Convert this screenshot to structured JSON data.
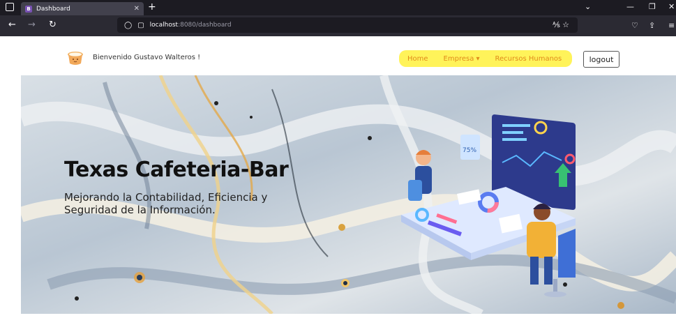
{
  "browser": {
    "tab_title": "Dashboard",
    "tab_favicon": "B",
    "url_host": "localhost",
    "url_path": ":8080/dashboard"
  },
  "header": {
    "welcome": "Bienvenido Gustavo Walteros !",
    "nav": {
      "home": "Home",
      "empresa": "Empresa ▾",
      "rrhh": "Recursos Humanos"
    },
    "logout": "logout"
  },
  "hero": {
    "title": "Texas Cafeteria-Bar",
    "subtitle": "Mejorando la Contabilidad, Eficiencia y Seguridad de la Información.",
    "badge": "75%"
  },
  "colors": {
    "nav_highlight": "#fff35a",
    "nav_text": "#e08a1a",
    "chrome_dark": "#1c1b22"
  }
}
